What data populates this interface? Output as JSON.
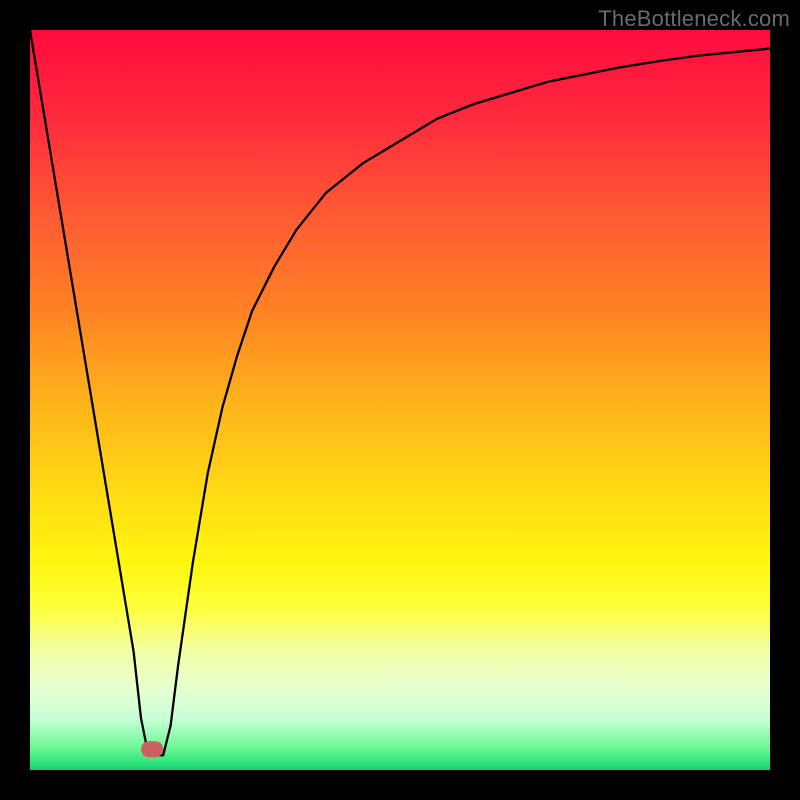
{
  "watermark": "TheBottleneck.com",
  "colors": {
    "frame": "#000000",
    "gradient_top": "#ff0b3d",
    "gradient_bottom": "#18cd76",
    "curve": "#000000",
    "marker": "#cb615e"
  },
  "chart_data": {
    "type": "line",
    "title": "",
    "xlabel": "",
    "ylabel": "",
    "xlim": [
      0,
      100
    ],
    "ylim": [
      0,
      100
    ],
    "grid": false,
    "legend": false,
    "series": [
      {
        "name": "bottleneck-curve",
        "x": [
          0,
          2,
          4,
          6,
          8,
          10,
          12,
          14,
          15,
          16,
          17,
          18,
          19,
          20,
          22,
          24,
          26,
          28,
          30,
          33,
          36,
          40,
          45,
          50,
          55,
          60,
          65,
          70,
          75,
          80,
          85,
          90,
          95,
          100
        ],
        "y": [
          100,
          88,
          76,
          64,
          52,
          40,
          28,
          16,
          7,
          2,
          2,
          2,
          6,
          14,
          28,
          40,
          49,
          56,
          62,
          68,
          73,
          78,
          82,
          85,
          88,
          90,
          91.5,
          93,
          94,
          95,
          95.8,
          96.5,
          97,
          97.5
        ]
      }
    ],
    "marker": {
      "name": "optimal-range",
      "x_range": [
        15,
        18
      ],
      "y": 2
    }
  }
}
